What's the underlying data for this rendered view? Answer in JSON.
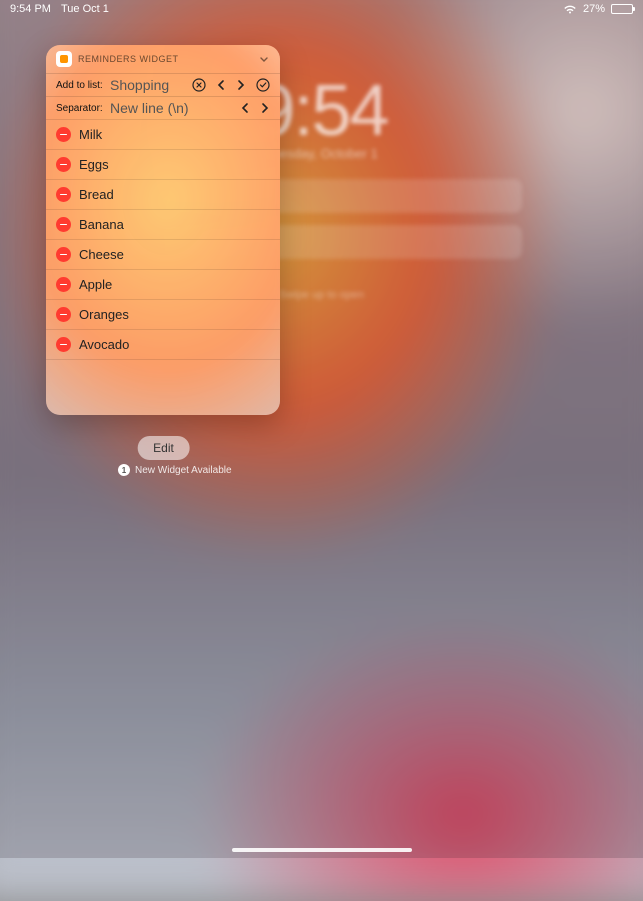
{
  "statusBar": {
    "time": "9:54 PM",
    "date": "Tue Oct 1",
    "batteryPercent": "27%"
  },
  "lockScreen": {
    "time": "9:54",
    "date": "Tuesday, October 1",
    "hint": "Swipe up to open"
  },
  "widget": {
    "title": "REMINDERS WIDGET",
    "controls": {
      "addToList": {
        "label": "Add to list:",
        "value": "Shopping"
      },
      "separator": {
        "label": "Separator:",
        "value": "New line (\\n)"
      }
    },
    "items": [
      {
        "label": "Milk"
      },
      {
        "label": "Eggs"
      },
      {
        "label": "Bread"
      },
      {
        "label": "Banana"
      },
      {
        "label": "Cheese"
      },
      {
        "label": "Apple"
      },
      {
        "label": "Oranges"
      },
      {
        "label": "Avocado"
      }
    ]
  },
  "editButton": "Edit",
  "newWidget": {
    "count": "1",
    "label": "New Widget Available"
  }
}
